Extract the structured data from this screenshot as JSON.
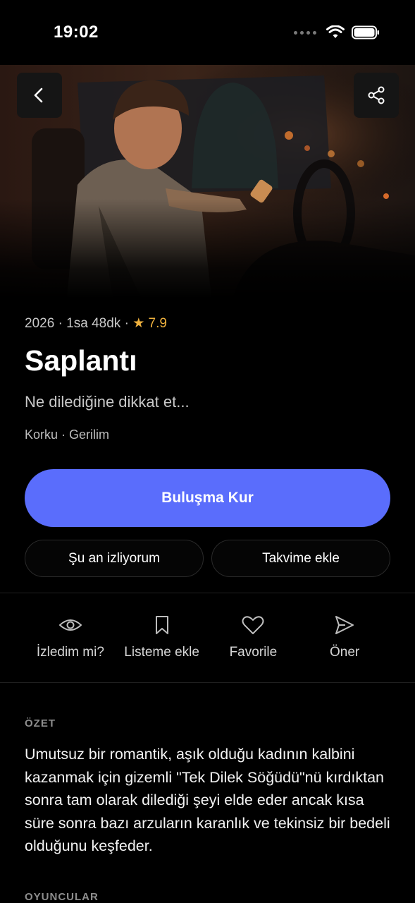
{
  "status_bar": {
    "time": "19:02"
  },
  "header": {
    "back_icon": "chevron-left-icon",
    "share_icon": "share-icon"
  },
  "movie": {
    "year": "2026",
    "duration": "1sa 48dk",
    "rating": "7.9",
    "title": "Saplantı",
    "tagline": "Ne dilediğine dikkat et...",
    "genres": "Korku · Gerilim"
  },
  "buttons": {
    "primary": "Buluşma Kur",
    "watching": "Şu an izliyorum",
    "calendar": "Takvime ekle"
  },
  "actions": [
    {
      "icon": "eye-icon",
      "label": "İzledim mi?"
    },
    {
      "icon": "bookmark-icon",
      "label": "Listeme ekle"
    },
    {
      "icon": "heart-icon",
      "label": "Favorile"
    },
    {
      "icon": "send-icon",
      "label": "Öner"
    }
  ],
  "sections": {
    "summary_label": "ÖZET",
    "summary_text": "Umutsuz bir romantik, aşık olduğu kadının kalbini kazanmak için gizemli \"Tek Dilek Söğüdü\"nü kırdıktan sonra tam olarak dilediği şeyi elde eder ancak kısa süre sonra bazı arzuların karanlık ve tekinsiz bir bedeli olduğunu keşfeder.",
    "cast_label": "OYUNCULAR"
  },
  "colors": {
    "accent": "#5a6dfc",
    "star": "#f0b23e",
    "background": "#000000"
  }
}
